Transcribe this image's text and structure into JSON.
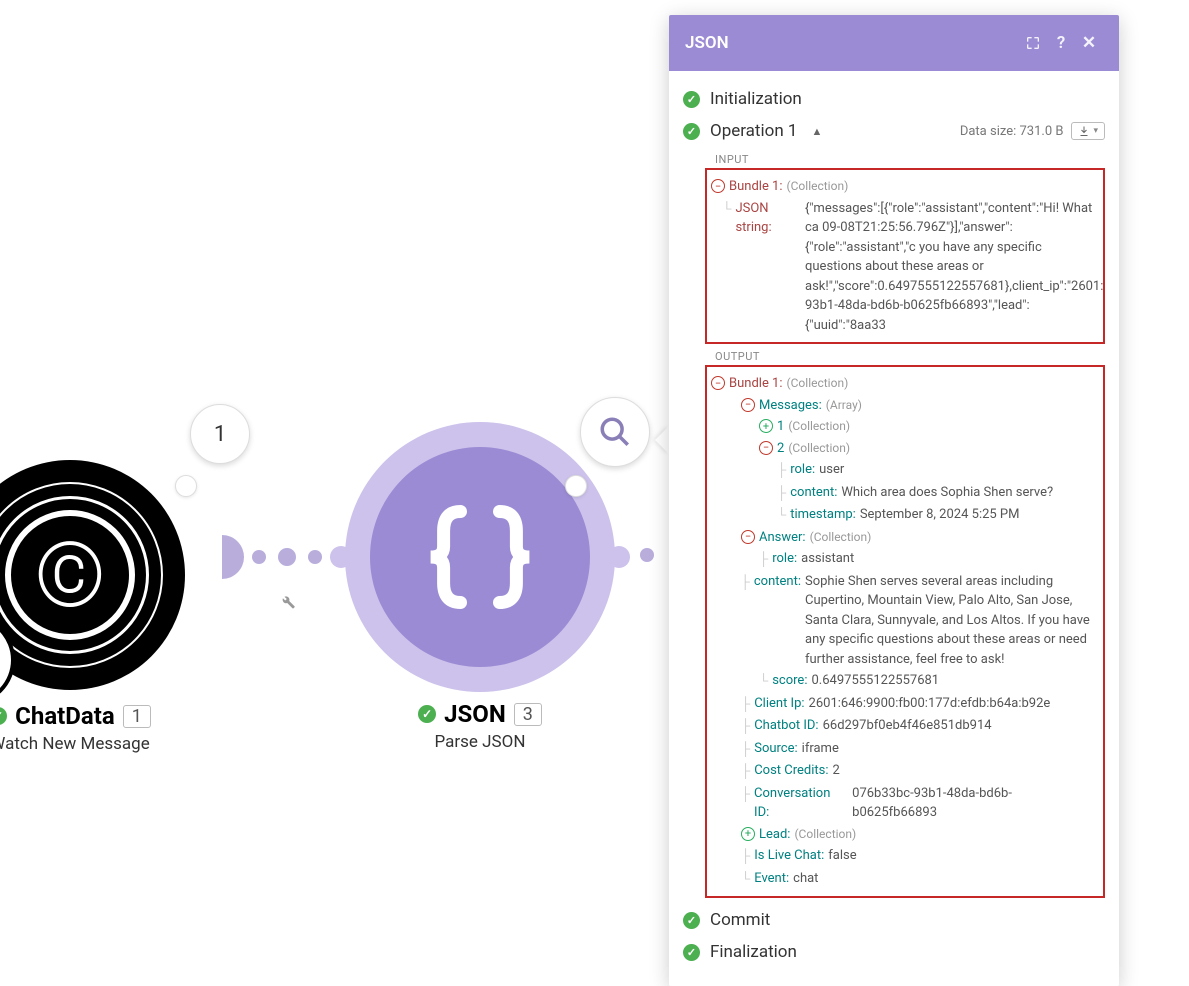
{
  "nodes": {
    "chatdata": {
      "title": "ChatData",
      "count": "1",
      "subtitle": "Watch New Message",
      "bubble": "1"
    },
    "json": {
      "title": "JSON",
      "count": "3",
      "subtitle": "Parse JSON"
    }
  },
  "panel": {
    "title": "JSON",
    "stages": {
      "init": "Initialization",
      "op1": "Operation 1",
      "commit": "Commit",
      "final": "Finalization"
    },
    "datasize_label": "Data size:",
    "datasize_value": "731.0 B",
    "section_input": "INPUT",
    "section_output": "OUTPUT",
    "bundle_label": "Bundle 1:",
    "collection_meta": "(Collection)",
    "array_meta": "(Array)",
    "input": {
      "json_string_key": "JSON string:",
      "json_string_value": "{\"messages\":[{\"role\":\"assistant\",\"content\":\"Hi! What ca 09-08T21:25:56.796Z\"}],\"answer\":{\"role\":\"assistant\",\"c you have any specific questions about these areas or ask!\",\"score\":0.6497555122557681},client_ip\":\"2601: 93b1-48da-bd6b-b0625fb66893\",\"lead\":{\"uuid\":\"8aa33"
    },
    "output": {
      "messages_key": "Messages:",
      "msg1_key": "1",
      "msg2_key": "2",
      "role_key": "role:",
      "content_key": "content:",
      "timestamp_key": "timestamp:",
      "msg2": {
        "role": "user",
        "content": "Which area does Sophia Shen serve?",
        "timestamp": "September 8, 2024 5:25 PM"
      },
      "answer_key": "Answer:",
      "answer": {
        "role": "assistant",
        "content": "Sophie Shen serves several areas including Cupertino, Mountain View, Palo Alto, San Jose, Santa Clara, Sunnyvale, and Los Altos. If you have any specific questions about these areas or need further assistance, feel free to ask!"
      },
      "score_key": "score:",
      "score": "0.6497555122557681",
      "client_ip_key": "Client Ip:",
      "client_ip": "2601:646:9900:fb00:177d:efdb:b64a:b92e",
      "chatbot_id_key": "Chatbot ID:",
      "chatbot_id": "66d297bf0eb4f46e851db914",
      "source_key": "Source:",
      "source": "iframe",
      "cost_key": "Cost Credits:",
      "cost": "2",
      "conv_id_key": "Conversation ID:",
      "conv_id": "076b33bc-93b1-48da-bd6b-b0625fb66893",
      "lead_key": "Lead:",
      "livechat_key": "Is Live Chat:",
      "livechat": "false",
      "event_key": "Event:",
      "event": "chat"
    }
  }
}
